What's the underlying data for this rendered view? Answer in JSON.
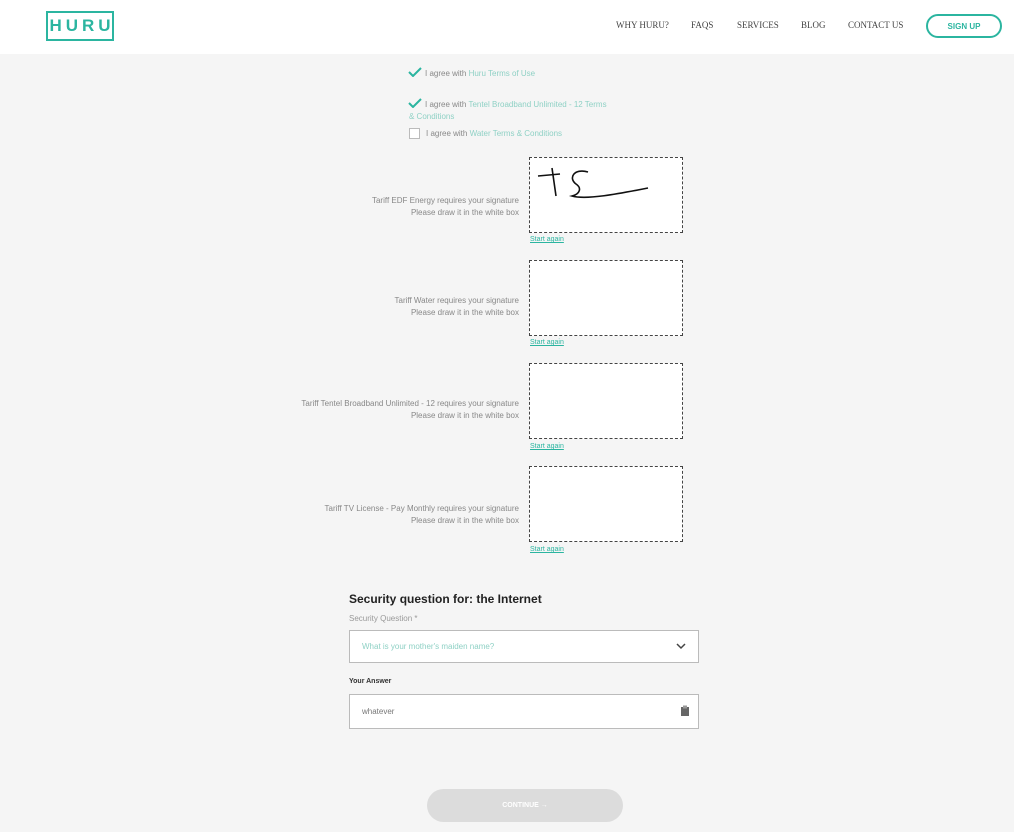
{
  "header": {
    "logo": "HURU",
    "nav": [
      "WHY HURU?",
      "FAQS",
      "SERVICES",
      "BLOG",
      "CONTACT US"
    ],
    "signup_label": "SIGN UP",
    "accent": "#2bb5a0"
  },
  "agreements": [
    {
      "prefix": "I agree with ",
      "link": "Huru Terms of Use",
      "checked": true
    },
    {
      "prefix": "I agree with ",
      "link": "Tentel Broadband Unlimited - 12 Terms",
      "link2": "& Conditions",
      "checked": true
    },
    {
      "prefix": "I agree with ",
      "link": "Water Terms & Conditions",
      "checked": false
    }
  ],
  "signatures": [
    {
      "line1": "Tariff EDF Energy requires your signature",
      "line2": "Please draw it in the white box",
      "start_again": "Start again",
      "signed": true
    },
    {
      "line1": "Tariff Water requires your signature",
      "line2": "Please draw it in the white box",
      "start_again": "Start again",
      "signed": false
    },
    {
      "line1": "Tariff Tentel Broadband Unlimited - 12 requires your signature",
      "line2": "Please draw it in the white box",
      "start_again": "Start again",
      "signed": false
    },
    {
      "line1": "Tariff TV License - Pay Monthly requires your signature",
      "line2": "Please draw it in the white box",
      "start_again": "Start again",
      "signed": false
    }
  ],
  "security": {
    "title": "Security question for: the Internet",
    "question_label": "Security Question *",
    "question_placeholder": "What is your mother's maiden name?",
    "answer_label": "Your Answer",
    "answer_value": "whatever"
  },
  "continue_label": "CONTINUE →"
}
